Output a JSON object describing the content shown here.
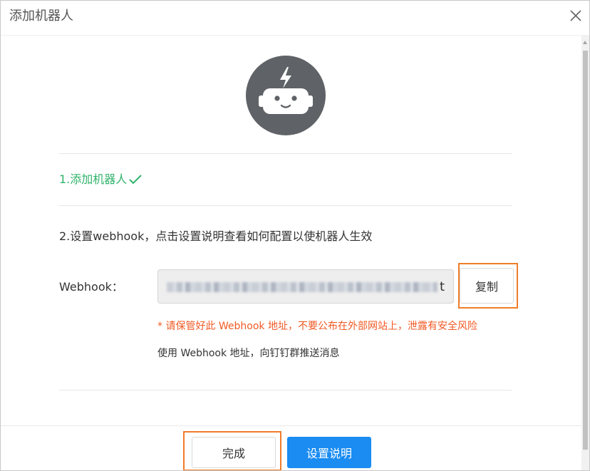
{
  "dialog": {
    "title": "添加机器人",
    "close_icon": "close-icon"
  },
  "avatar": {
    "icon": "robot-icon"
  },
  "step1": {
    "label": "1.添加机器人",
    "status_icon": "check-icon",
    "color": "#2fb36a"
  },
  "step2": {
    "label": "2.设置webhook，点击设置说明查看如何配置以使机器人生效"
  },
  "webhook": {
    "label": "Webhook：",
    "value_tail": "t",
    "copy_label": "复制",
    "warning": "* 请保管好此 Webhook 地址，不要公布在外部网站上，泄露有安全风险",
    "usage": "使用 Webhook 地址，向钉钉群推送消息"
  },
  "footer": {
    "done_label": "完成",
    "guide_label": "设置说明"
  },
  "colors": {
    "accent": "#1a8cf2",
    "warning": "#f05a24",
    "highlight": "#ef7d2a",
    "avatar_bg": "#5f6266"
  }
}
